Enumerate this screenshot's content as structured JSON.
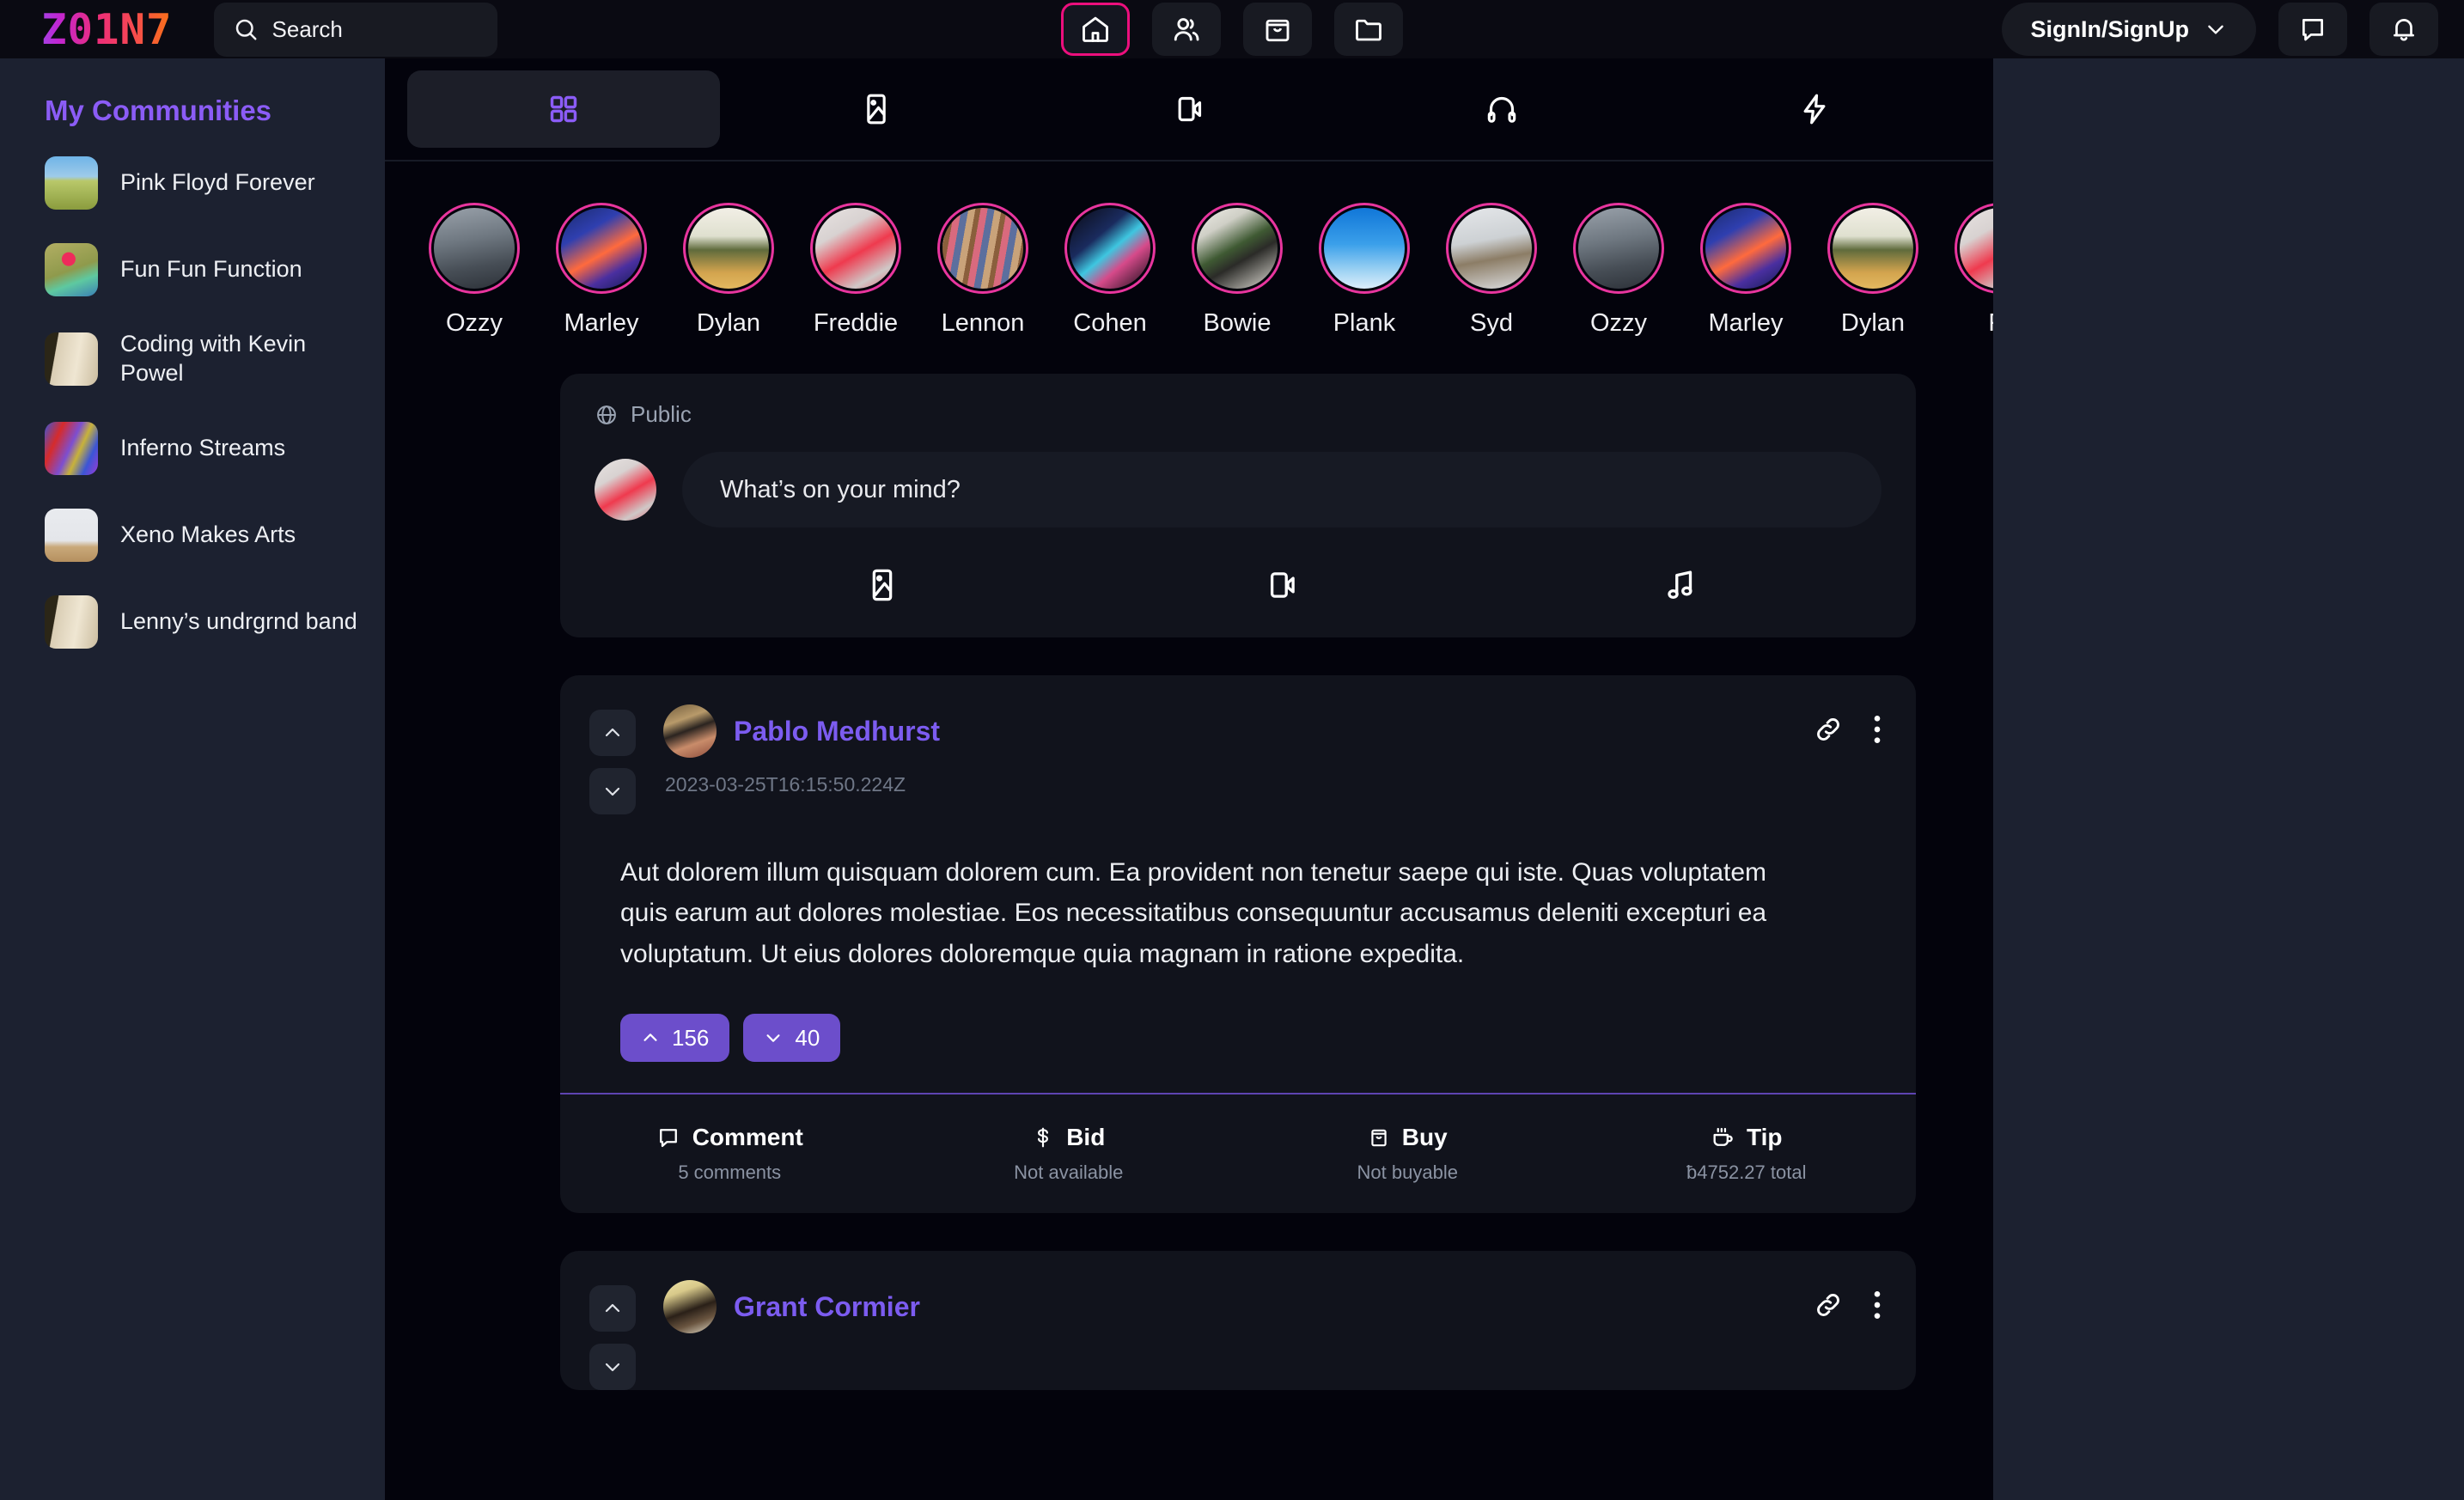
{
  "header": {
    "logo": "Z01N7",
    "search_placeholder": "Search",
    "nav": [
      {
        "name": "home",
        "label": "Home",
        "active": true
      },
      {
        "name": "people",
        "label": "People",
        "active": false
      },
      {
        "name": "shop",
        "label": "Shop",
        "active": false
      },
      {
        "name": "folder",
        "label": "Files",
        "active": false
      }
    ],
    "signin_label": "SignIn/SignUp",
    "messages_label": "Messages",
    "notifications_label": "Notifications",
    "active_border_color": "#ec0f7d"
  },
  "sidebar": {
    "title": "My Communities",
    "title_color": "#8b5cf6",
    "items": [
      {
        "label": "Pink Floyd Forever",
        "thumb": "th-pinkfloyd"
      },
      {
        "label": "Fun Fun Function",
        "thumb": "th-funfun"
      },
      {
        "label": "Coding with Kevin Powel",
        "thumb": "th-coding"
      },
      {
        "label": "Inferno Streams",
        "thumb": "th-inferno"
      },
      {
        "label": "Xeno Makes Arts",
        "thumb": "th-xeno"
      },
      {
        "label": "Lenny’s undrgrnd band",
        "thumb": "th-lenny"
      }
    ]
  },
  "tabs": [
    {
      "name": "grid",
      "label": "All",
      "active": true
    },
    {
      "name": "image",
      "label": "Images",
      "active": false
    },
    {
      "name": "video",
      "label": "Videos",
      "active": false
    },
    {
      "name": "audio",
      "label": "Audio",
      "active": false
    },
    {
      "name": "flash",
      "label": "Live",
      "active": false
    }
  ],
  "stories": [
    {
      "name": "Ozzy",
      "img": "s-ozzy"
    },
    {
      "name": "Marley",
      "img": "s-marley"
    },
    {
      "name": "Dylan",
      "img": "s-dylan"
    },
    {
      "name": "Freddie",
      "img": "s-freddie"
    },
    {
      "name": "Lennon",
      "img": "s-lennon"
    },
    {
      "name": "Cohen",
      "img": "s-cohen"
    },
    {
      "name": "Bowie",
      "img": "s-bowie"
    },
    {
      "name": "Plank",
      "img": "s-plank"
    },
    {
      "name": "Syd",
      "img": "s-syd"
    },
    {
      "name": "Ozzy",
      "img": "s-ozzy"
    },
    {
      "name": "Marley",
      "img": "s-marley"
    },
    {
      "name": "Dylan",
      "img": "s-dylan"
    },
    {
      "name": "Fr",
      "img": "s-freddie"
    }
  ],
  "composer": {
    "audience": "Public",
    "placeholder": "What’s on your mind?",
    "actions": [
      {
        "name": "photo",
        "label": "Photo"
      },
      {
        "name": "video",
        "label": "Video"
      },
      {
        "name": "music",
        "label": "Music"
      }
    ]
  },
  "posts": [
    {
      "author": "Pablo Medhurst",
      "avatar": "pa-pablo",
      "timestamp": "2023-03-25T16:15:50.224Z",
      "body": "Aut dolorem illum quisquam dolorem cum. Ea provident non tenetur saepe qui iste. Quas voluptatem quis earum aut dolores molestiae. Eos necessitatibus consequuntur accusamus deleniti excepturi ea voluptatum. Ut eius dolores doloremque quia magnam in ratione expedita.",
      "upvotes": "156",
      "downvotes": "40",
      "actions": [
        {
          "name": "comment",
          "label": "Comment",
          "sub": "5 comments"
        },
        {
          "name": "bid",
          "label": "Bid",
          "sub": "Not available"
        },
        {
          "name": "buy",
          "label": "Buy",
          "sub": "Not buyable"
        },
        {
          "name": "tip",
          "label": "Tip",
          "sub": "ƀ4752.27 total"
        }
      ]
    },
    {
      "author": "Grant Cormier",
      "avatar": "pa-grant",
      "timestamp": "",
      "body": "",
      "upvotes": "",
      "downvotes": "",
      "actions": []
    }
  ],
  "colors": {
    "accent_purple": "#8b5cf6",
    "accent_pink": "#ec0f7d",
    "vote_pill": "#6c4ecb",
    "page_bg": "#1c2130",
    "feed_bg": "#03030c",
    "card_bg": "#11131c"
  }
}
